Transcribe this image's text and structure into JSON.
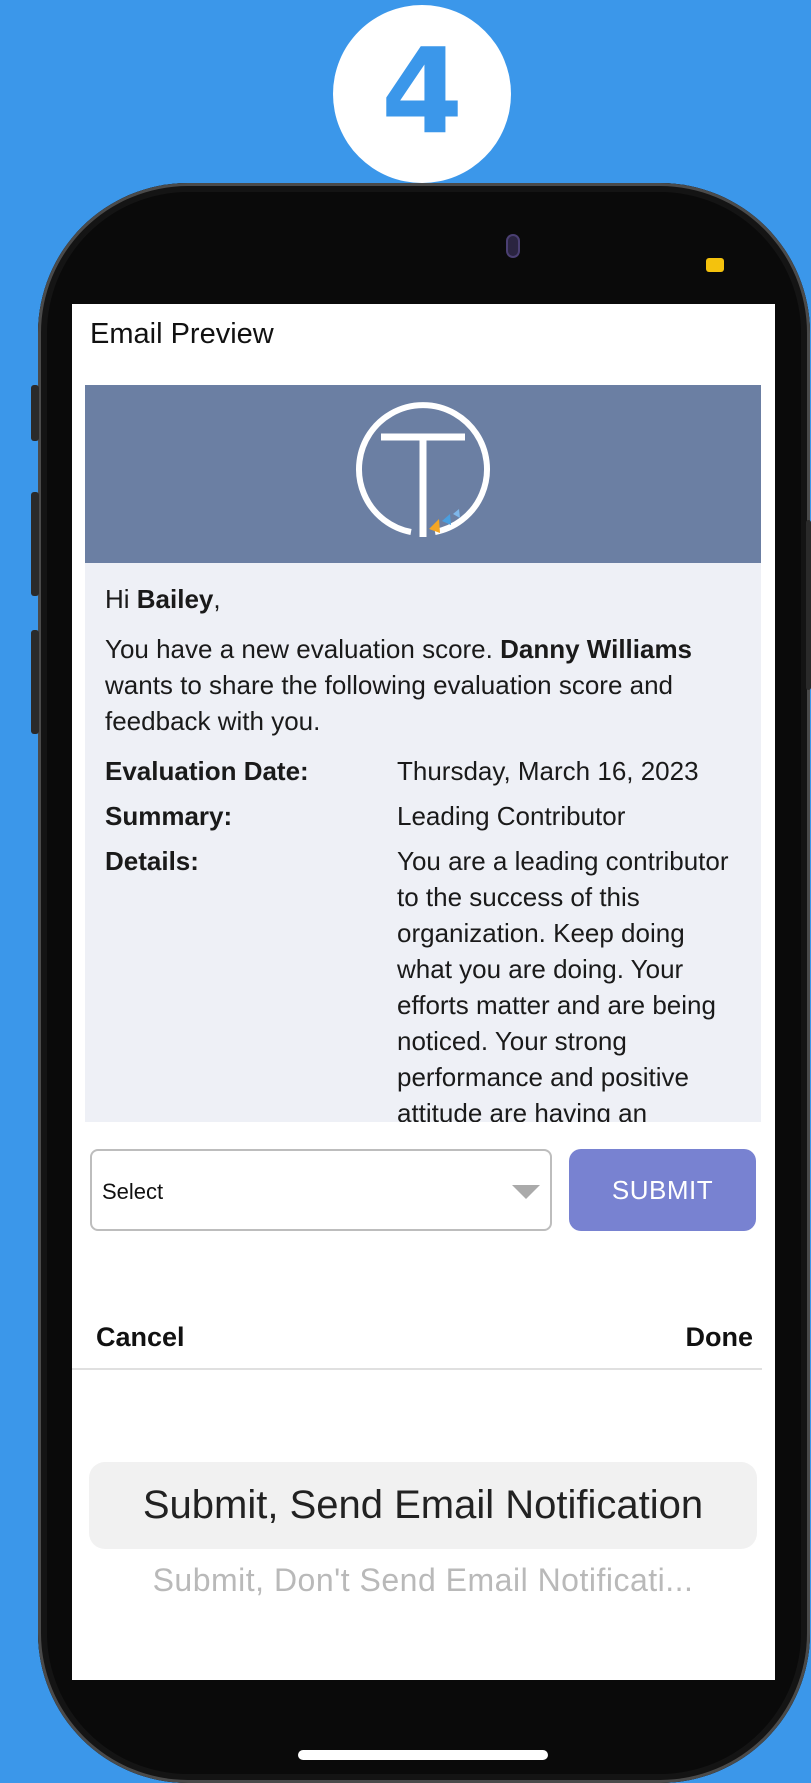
{
  "step_badge": "4",
  "screen_title": "Email Preview",
  "email": {
    "greeting_prefix": "Hi ",
    "recipient": "Bailey",
    "greeting_suffix": ",",
    "intro_before": "You have a new evaluation score. ",
    "sender": "Danny Williams",
    "intro_after": " wants to share the following evaluation score and feedback with you.",
    "fields": [
      {
        "label": "Evaluation Date:",
        "value": "Thursday, March 16, 2023"
      },
      {
        "label": "Summary:",
        "value": "Leading Contributor"
      },
      {
        "label": "Details:",
        "value": "You are a leading contributor to the success of this organization. Keep doing what you are doing. Your efforts matter and are being noticed. Your strong performance and positive attitude are having an"
      }
    ]
  },
  "form": {
    "select_value": "Select",
    "submit_label": "SUBMIT"
  },
  "picker_toolbar": {
    "cancel_label": "Cancel",
    "done_label": "Done"
  },
  "picker_options": [
    "Submit, Send Email Notification",
    "Submit, Don't Send Email Notificati..."
  ],
  "colors": {
    "background": "#3b97ea",
    "email_header": "#6b7fa3",
    "submit_button": "#7882d1",
    "status_dot": "#f4c20d"
  }
}
